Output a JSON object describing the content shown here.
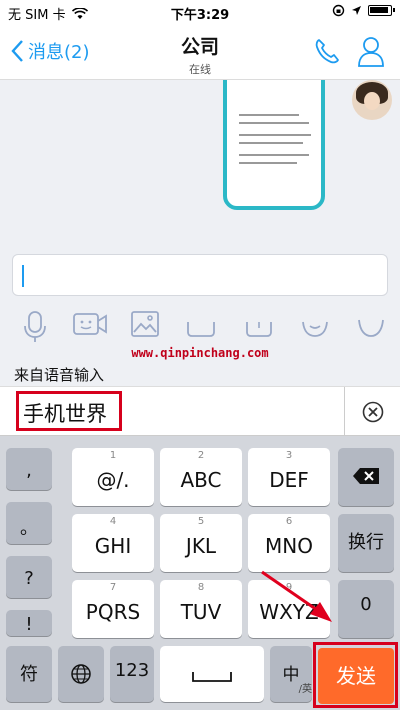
{
  "status_bar": {
    "carrier": "无 SIM 卡",
    "time": "下午3:29"
  },
  "nav": {
    "back_label": "消息(2)",
    "title": "公司",
    "subtitle": "在线"
  },
  "voice_input": {
    "label": "来自语音输入",
    "candidate": "手机世界"
  },
  "watermark": "www.qinpinchang.com",
  "keyboard": {
    "left_column": [
      ",",
      "。",
      "?",
      "!"
    ],
    "keys": [
      {
        "num": "1",
        "label": "@/."
      },
      {
        "num": "2",
        "label": "ABC"
      },
      {
        "num": "3",
        "label": "DEF"
      },
      {
        "num": "4",
        "label": "GHI"
      },
      {
        "num": "5",
        "label": "JKL"
      },
      {
        "num": "6",
        "label": "MNO"
      },
      {
        "num": "7",
        "label": "PQRS"
      },
      {
        "num": "8",
        "label": "TUV"
      },
      {
        "num": "9",
        "label": "WXYZ"
      }
    ],
    "newline": "换行",
    "zero": "0",
    "symbol": "符",
    "numbers": "123",
    "lang": "中",
    "lang_sub": "/英",
    "send": "发送"
  },
  "colors": {
    "accent": "#1d9bf0",
    "send": "#ff6a2a",
    "highlight": "#d6001c"
  }
}
